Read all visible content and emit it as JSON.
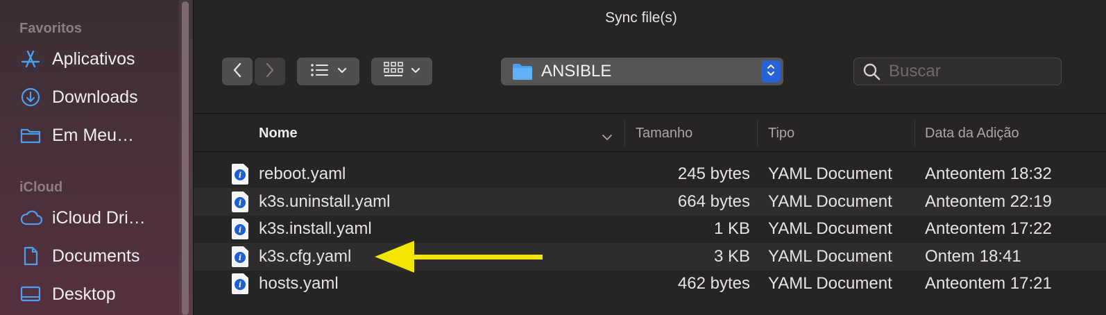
{
  "window": {
    "title": "Sync file(s)"
  },
  "sidebar": {
    "favorites_heading": "Favoritos",
    "icloud_heading": "iCloud",
    "favorites": [
      {
        "label": "Aplicativos",
        "icon": "applications-icon"
      },
      {
        "label": "Downloads",
        "icon": "downloads-icon"
      },
      {
        "label": "Em Meu…",
        "icon": "folder-icon"
      }
    ],
    "icloud": [
      {
        "label": "iCloud Dri…",
        "icon": "cloud-icon"
      },
      {
        "label": "Documents",
        "icon": "document-icon"
      },
      {
        "label": "Desktop",
        "icon": "desktop-icon"
      }
    ]
  },
  "toolbar": {
    "location": "ANSIBLE",
    "search_placeholder": "Buscar"
  },
  "table": {
    "columns": [
      "Nome",
      "Tamanho",
      "Tipo",
      "Data da Adição"
    ],
    "rows": [
      {
        "name": "reboot.yaml",
        "size": "245 bytes",
        "kind": "YAML Document",
        "date": "Anteontem 18:32"
      },
      {
        "name": "k3s.uninstall.yaml",
        "size": "664 bytes",
        "kind": "YAML Document",
        "date": "Anteontem 22:19"
      },
      {
        "name": "k3s.install.yaml",
        "size": "1 KB",
        "kind": "YAML Document",
        "date": "Anteontem 17:22"
      },
      {
        "name": "k3s.cfg.yaml",
        "size": "3 KB",
        "kind": "YAML Document",
        "date": "Ontem 18:41"
      },
      {
        "name": "hosts.yaml",
        "size": "462 bytes",
        "kind": "YAML Document",
        "date": "Anteontem 17:21"
      }
    ]
  },
  "colors": {
    "accent": "#2563d6",
    "arrow": "#f2e600",
    "folder": "#4a9ff0"
  }
}
